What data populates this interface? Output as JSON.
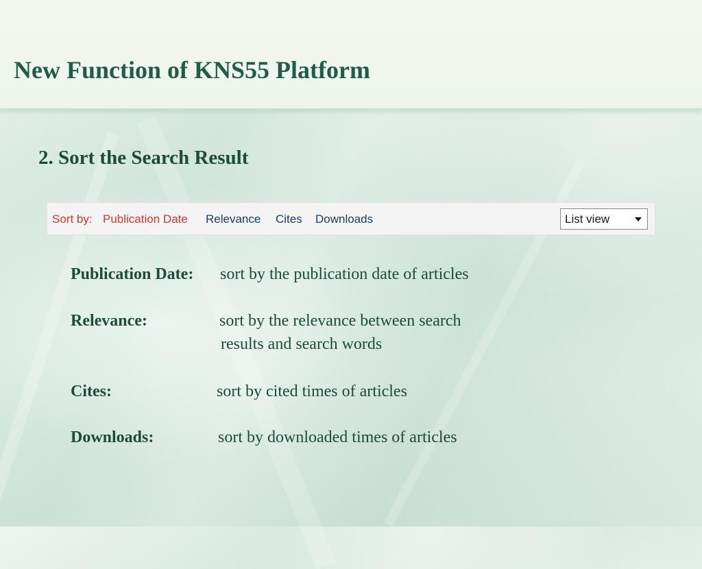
{
  "slide": {
    "title": "New Function of KNS55 Platform",
    "section": "2. Sort the Search Result"
  },
  "sort_bar": {
    "label": "Sort by:",
    "options": [
      "Publication Date",
      "Relevance",
      "Cites",
      "Downloads"
    ],
    "active_option": "Publication Date",
    "view_select": {
      "selected": "List view"
    },
    "colors": {
      "active": "#d9342b",
      "inactive": "#1a3c6e"
    }
  },
  "definitions": [
    {
      "term": "Publication Date:",
      "desc_lines": [
        "sort by the publication date of articles"
      ]
    },
    {
      "term": "Relevance:",
      "desc_lines": [
        "sort by the relevance between search",
        "results and search words"
      ]
    },
    {
      "term": "Cites:",
      "desc_lines": [
        "sort by cited times of articles"
      ]
    },
    {
      "term": "Downloads:",
      "desc_lines": [
        "sort by downloaded times of articles"
      ]
    }
  ],
  "icons": {
    "view_select_caret": "chevron-down-icon"
  },
  "colors": {
    "title": "#1f5e45",
    "text": "#1e4a38"
  }
}
